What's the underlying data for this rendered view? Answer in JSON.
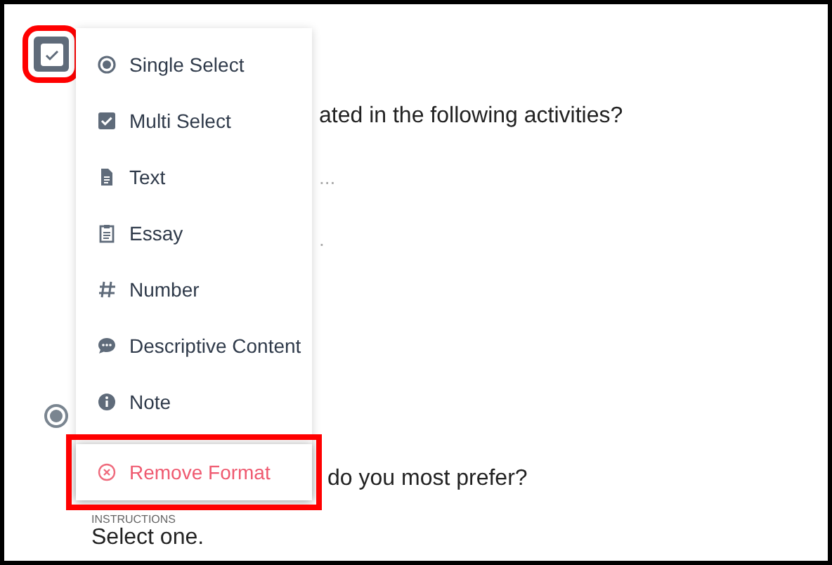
{
  "trigger": {
    "highlighted": true
  },
  "menu": {
    "items": [
      {
        "kind": "radio",
        "label": "Single Select",
        "highlighted": false
      },
      {
        "kind": "checkbox",
        "label": "Multi Select",
        "highlighted": false
      },
      {
        "kind": "text",
        "label": "Text",
        "highlighted": false
      },
      {
        "kind": "essay",
        "label": "Essay",
        "highlighted": false
      },
      {
        "kind": "number",
        "label": "Number",
        "highlighted": false
      },
      {
        "kind": "comment",
        "label": "Descriptive Content",
        "highlighted": false
      },
      {
        "kind": "info",
        "label": "Note",
        "highlighted": false
      },
      {
        "kind": "remove",
        "label": "Remove Format",
        "highlighted": true
      }
    ]
  },
  "question_1": {
    "text": "ated in the following activities?",
    "placeholder": "...",
    "line_3": "."
  },
  "question_2": {
    "text": "do you most prefer?",
    "instructions_label": "INSTRUCTIONS",
    "instructions": "Select one."
  }
}
